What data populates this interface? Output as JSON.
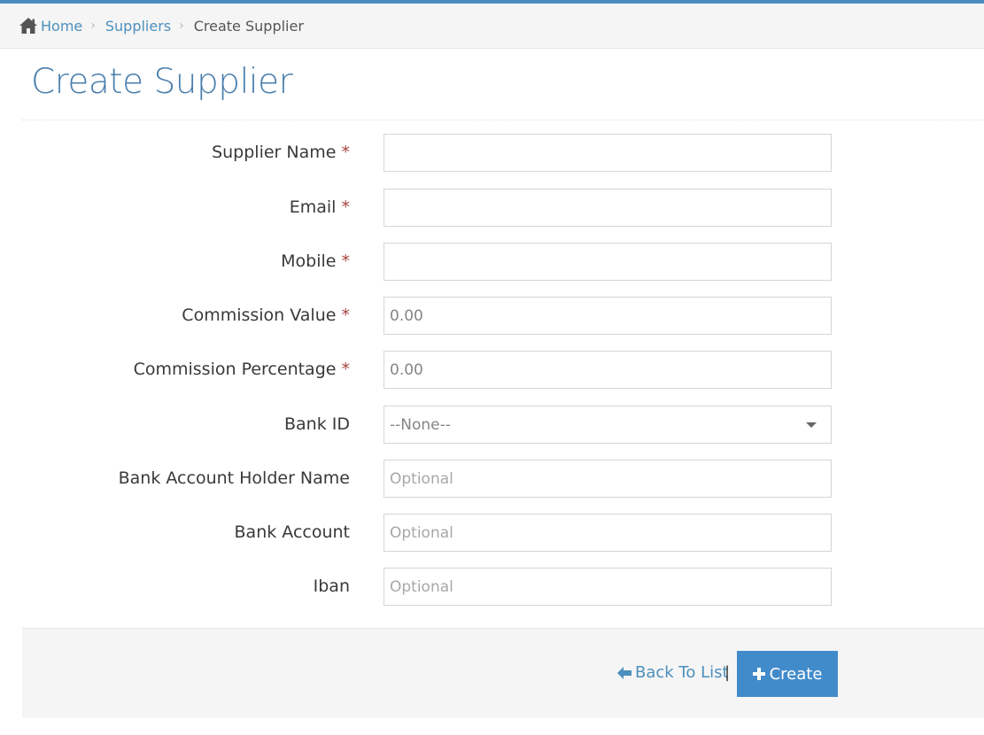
{
  "breadcrumbs": {
    "home": "Home",
    "suppliers": "Suppliers",
    "current": "Create Supplier",
    "separator": "›"
  },
  "page": {
    "title": "Create Supplier"
  },
  "form": {
    "required_marker": "*",
    "fields": [
      {
        "label": "Supplier Name",
        "required": true,
        "value": "",
        "placeholder": ""
      },
      {
        "label": "Email",
        "required": true,
        "value": "",
        "placeholder": ""
      },
      {
        "label": "Mobile",
        "required": true,
        "value": "",
        "placeholder": ""
      },
      {
        "label": "Commission Value",
        "required": true,
        "value": "0.00",
        "placeholder": ""
      },
      {
        "label": "Commission Percentage",
        "required": true,
        "value": "0.00",
        "placeholder": ""
      },
      {
        "label": "Bank ID",
        "required": false,
        "value": "--None--",
        "type": "select"
      },
      {
        "label": "Bank Account Holder Name",
        "required": false,
        "value": "",
        "placeholder": "Optional"
      },
      {
        "label": "Bank Account",
        "required": false,
        "value": "",
        "placeholder": "Optional"
      },
      {
        "label": "Iban",
        "required": false,
        "value": "",
        "placeholder": "Optional"
      }
    ]
  },
  "actions": {
    "back_label": "Back To List",
    "divider": "|",
    "create_label": "Create"
  },
  "colors": {
    "accent": "#428bca",
    "link": "#4c8fbd",
    "title": "#4a7ead",
    "required": "#a94442"
  }
}
